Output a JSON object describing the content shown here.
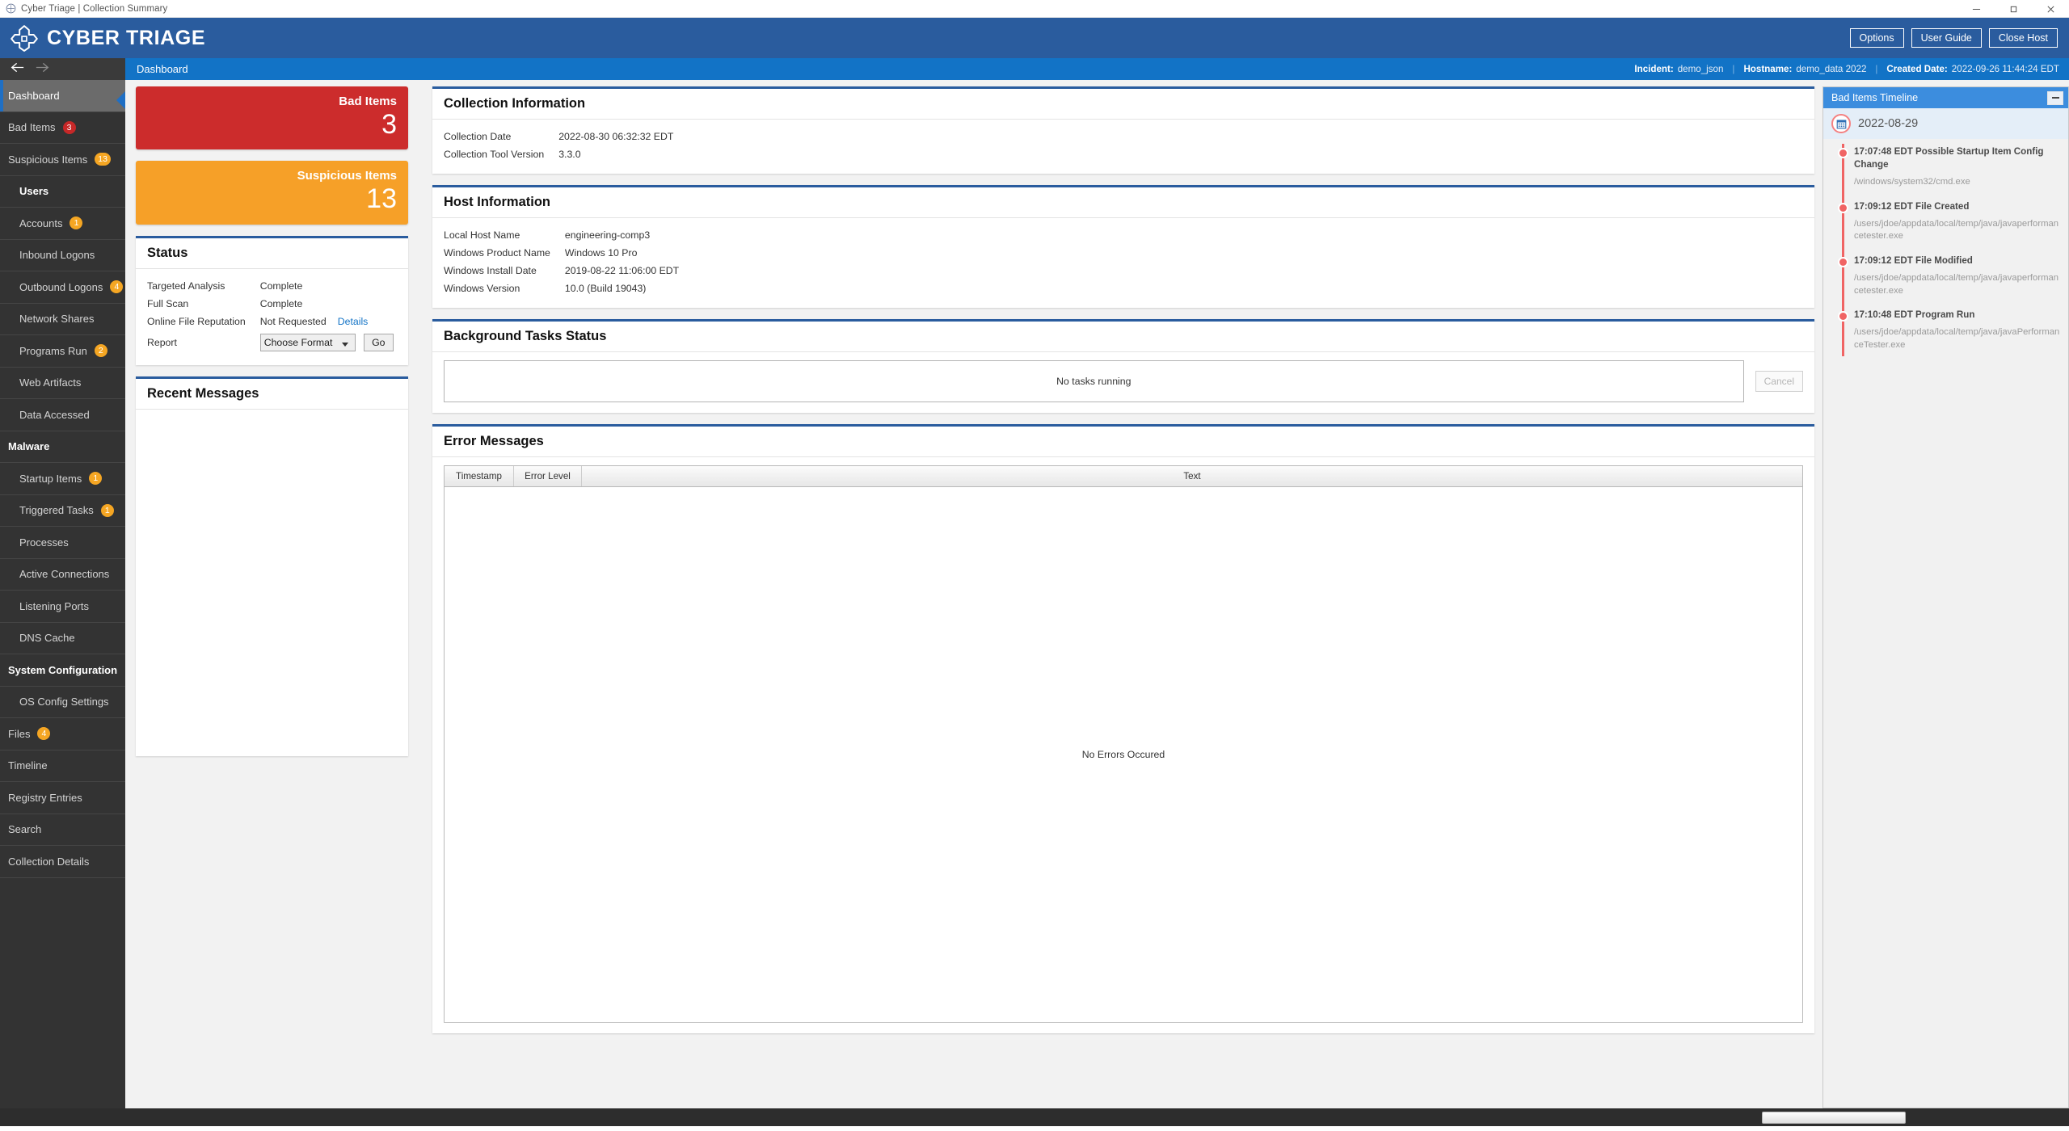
{
  "window": {
    "title": "Cyber Triage | Collection Summary",
    "controls": {
      "minimize": "minimize-icon",
      "maximize": "maximize-icon",
      "close": "close-icon"
    }
  },
  "brand": {
    "name": "CYBER TRIAGE",
    "logo_icon": "cyber-triage-logo",
    "buttons": [
      {
        "label": "Options",
        "name": "options-button"
      },
      {
        "label": "User Guide",
        "name": "user-guide-button"
      },
      {
        "label": "Close Host",
        "name": "close-host-button"
      }
    ]
  },
  "navstrip": {
    "back_icon": "arrow-left-icon",
    "forward_icon": "arrow-right-icon",
    "breadcrumb": "Dashboard",
    "info": [
      {
        "label": "Incident:",
        "value": "demo_json"
      },
      {
        "label": "Hostname:",
        "value": "demo_data 2022"
      },
      {
        "label": "Created Date:",
        "value": "2022-09-26 11:44:24 EDT"
      }
    ]
  },
  "sidebar": {
    "items": [
      {
        "label": "Dashboard",
        "active": true,
        "indent": false,
        "group": false,
        "badge": null,
        "badge_color": null
      },
      {
        "label": "Bad Items",
        "active": false,
        "indent": false,
        "group": false,
        "badge": "3",
        "badge_color": "red"
      },
      {
        "label": "Suspicious Items",
        "active": false,
        "indent": false,
        "group": false,
        "badge": "13",
        "badge_color": "orange"
      },
      {
        "label": "Users",
        "active": false,
        "indent": true,
        "group": true,
        "badge": null,
        "badge_color": null
      },
      {
        "label": "Accounts",
        "active": false,
        "indent": true,
        "group": false,
        "badge": "1",
        "badge_color": "orange"
      },
      {
        "label": "Inbound Logons",
        "active": false,
        "indent": true,
        "group": false,
        "badge": null,
        "badge_color": null
      },
      {
        "label": "Outbound Logons",
        "active": false,
        "indent": true,
        "group": false,
        "badge": "4",
        "badge_color": "orange"
      },
      {
        "label": "Network Shares",
        "active": false,
        "indent": true,
        "group": false,
        "badge": null,
        "badge_color": null
      },
      {
        "label": "Programs Run",
        "active": false,
        "indent": true,
        "group": false,
        "badge": "2",
        "badge_color": "orange"
      },
      {
        "label": "Web Artifacts",
        "active": false,
        "indent": true,
        "group": false,
        "badge": null,
        "badge_color": null
      },
      {
        "label": "Data Accessed",
        "active": false,
        "indent": true,
        "group": false,
        "badge": null,
        "badge_color": null
      },
      {
        "label": "Malware",
        "active": false,
        "indent": false,
        "group": true,
        "badge": null,
        "badge_color": null
      },
      {
        "label": "Startup Items",
        "active": false,
        "indent": true,
        "group": false,
        "badge": "1",
        "badge_color": "orange"
      },
      {
        "label": "Triggered Tasks",
        "active": false,
        "indent": true,
        "group": false,
        "badge": "1",
        "badge_color": "orange"
      },
      {
        "label": "Processes",
        "active": false,
        "indent": true,
        "group": false,
        "badge": null,
        "badge_color": null
      },
      {
        "label": "Active Connections",
        "active": false,
        "indent": true,
        "group": false,
        "badge": null,
        "badge_color": null
      },
      {
        "label": "Listening Ports",
        "active": false,
        "indent": true,
        "group": false,
        "badge": null,
        "badge_color": null
      },
      {
        "label": "DNS Cache",
        "active": false,
        "indent": true,
        "group": false,
        "badge": null,
        "badge_color": null
      },
      {
        "label": "System Configuration",
        "active": false,
        "indent": false,
        "group": true,
        "badge": null,
        "badge_color": null
      },
      {
        "label": "OS Config Settings",
        "active": false,
        "indent": true,
        "group": false,
        "badge": null,
        "badge_color": null
      },
      {
        "label": "Files",
        "active": false,
        "indent": false,
        "group": false,
        "badge": "4",
        "badge_color": "orange"
      },
      {
        "label": "Timeline",
        "active": false,
        "indent": false,
        "group": false,
        "badge": null,
        "badge_color": null
      },
      {
        "label": "Registry Entries",
        "active": false,
        "indent": false,
        "group": false,
        "badge": null,
        "badge_color": null
      },
      {
        "label": "Search",
        "active": false,
        "indent": false,
        "group": false,
        "badge": null,
        "badge_color": null
      },
      {
        "label": "Collection Details",
        "active": false,
        "indent": false,
        "group": false,
        "badge": null,
        "badge_color": null
      }
    ]
  },
  "cards": [
    {
      "label": "Bad Items",
      "value": "3",
      "color": "#cc2c2c",
      "name": "bad-items-card"
    },
    {
      "label": "Suspicious Items",
      "value": "13",
      "color": "#f6a028",
      "name": "suspicious-items-card"
    }
  ],
  "status_panel": {
    "title": "Status",
    "rows": [
      {
        "key": "Targeted Analysis",
        "value": "Complete"
      },
      {
        "key": "Full Scan",
        "value": "Complete"
      },
      {
        "key": "Online File Reputation",
        "value": "Not Requested",
        "link": "Details"
      }
    ],
    "report": {
      "key": "Report",
      "select_value": "Choose Format",
      "options": [
        "Choose Format"
      ],
      "go_label": "Go"
    }
  },
  "recent_messages": {
    "title": "Recent Messages",
    "body": ""
  },
  "collection_info": {
    "title": "Collection Information",
    "rows": [
      {
        "key": "Collection Date",
        "value": "2022-08-30 06:32:32 EDT"
      },
      {
        "key": "Collection Tool Version",
        "value": "3.3.0"
      }
    ]
  },
  "host_info": {
    "title": "Host Information",
    "rows": [
      {
        "key": "Local Host Name",
        "value": "engineering-comp3"
      },
      {
        "key": "Windows Product Name",
        "value": "Windows 10 Pro"
      },
      {
        "key": "Windows Install Date",
        "value": "2019-08-22 11:06:00 EDT"
      },
      {
        "key": "Windows Version",
        "value": "10.0 (Build 19043)"
      }
    ]
  },
  "background_tasks": {
    "title": "Background Tasks Status",
    "empty_text": "No tasks running",
    "cancel_label": "Cancel"
  },
  "error_messages": {
    "title": "Error Messages",
    "columns": [
      "Timestamp",
      "Error Level",
      "Text"
    ],
    "empty_text": "No Errors Occured",
    "rows": []
  },
  "timeline": {
    "title": "Bad Items Timeline",
    "minimize_icon": "minimize-icon",
    "calendar_icon": "calendar-icon",
    "date": "2022-08-29",
    "events": [
      {
        "title": "17:07:48 EDT Possible Startup Item Config Change",
        "path": "/windows/system32/cmd.exe"
      },
      {
        "title": "17:09:12 EDT File Created",
        "path": "/users/jdoe/appdata/local/temp/java/javaperformancetester.exe"
      },
      {
        "title": "17:09:12 EDT File Modified",
        "path": "/users/jdoe/appdata/local/temp/java/javaperformancetester.exe"
      },
      {
        "title": "17:10:48 EDT Program Run",
        "path": "/users/jdoe/appdata/local/temp/java/javaPerformanceTester.exe"
      }
    ]
  }
}
